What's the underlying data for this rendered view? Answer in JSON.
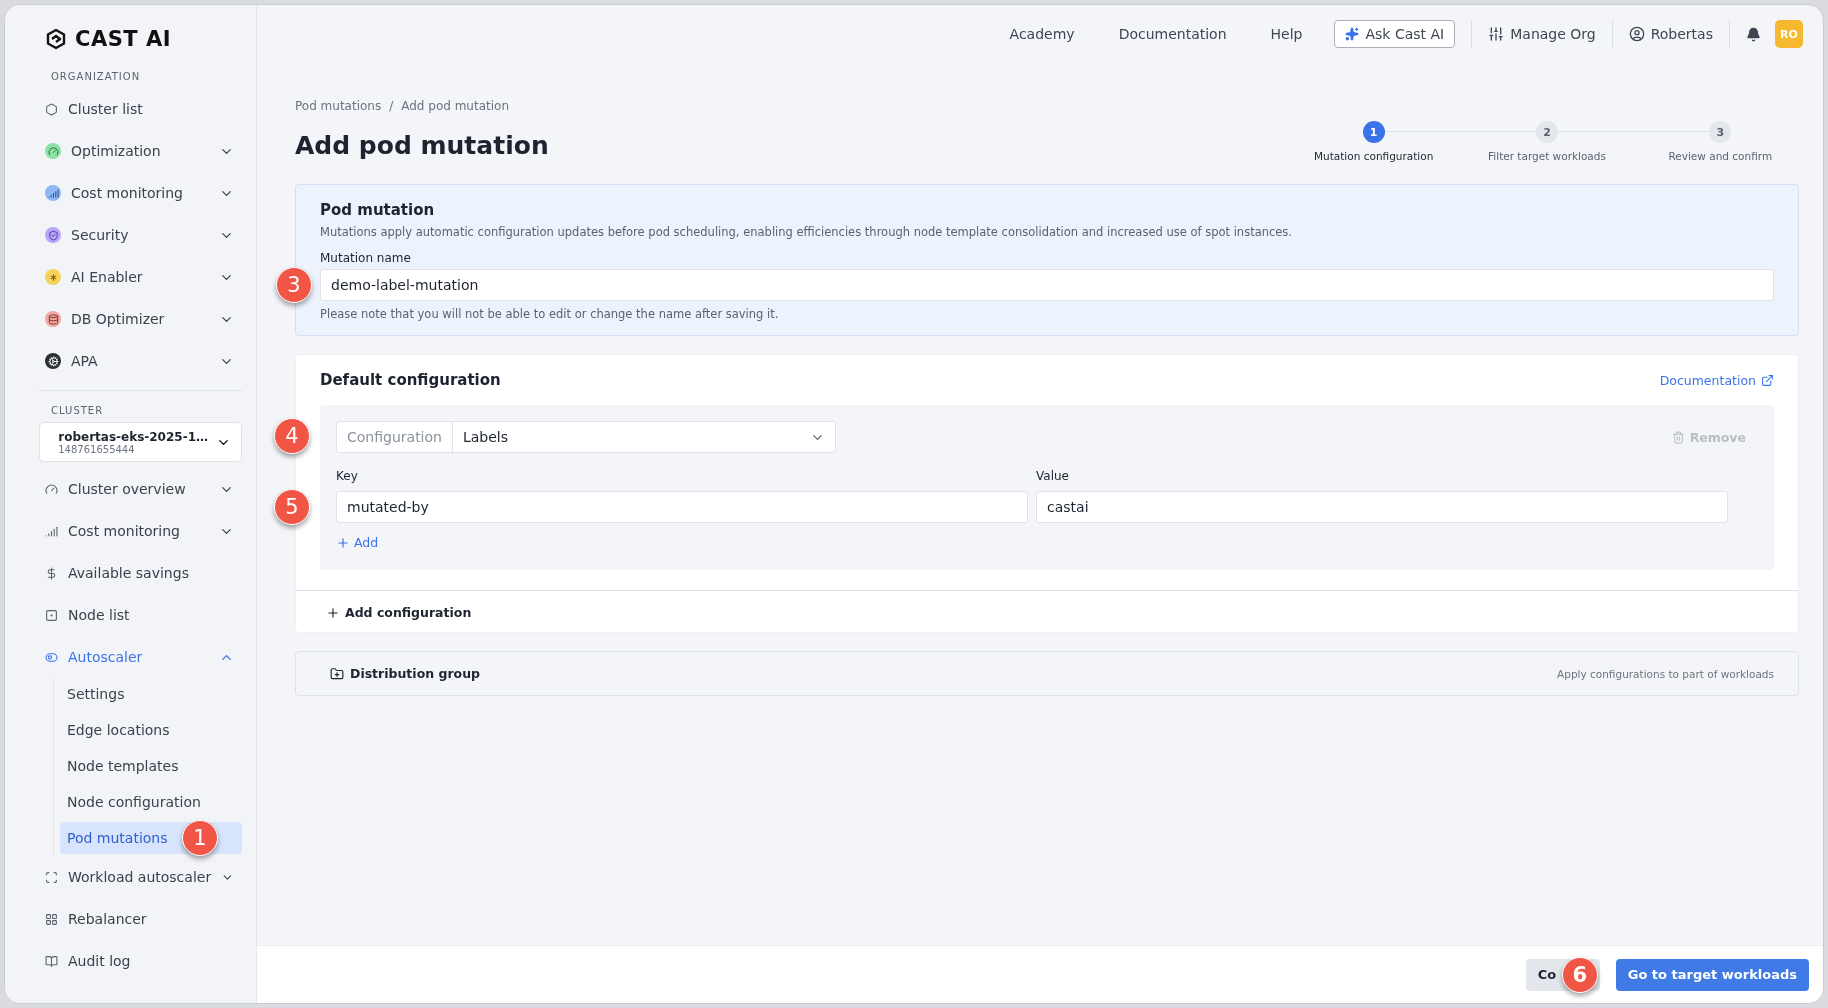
{
  "logo": {
    "text": "CAST AI"
  },
  "sidebar": {
    "sections": [
      {
        "heading": "ORGANIZATION",
        "items": [
          {
            "label": "Cluster list",
            "kind": "link",
            "selected": false
          },
          {
            "label": "Optimization",
            "kind": "group",
            "expanded": false,
            "selected": false
          },
          {
            "label": "Cost monitoring",
            "kind": "group",
            "expanded": false,
            "selected": false
          },
          {
            "label": "Security",
            "kind": "group",
            "expanded": false,
            "selected": false
          },
          {
            "label": "AI Enabler",
            "kind": "group",
            "expanded": false,
            "selected": false
          },
          {
            "label": "DB Optimizer",
            "kind": "group",
            "expanded": false,
            "selected": false
          },
          {
            "label": "APA",
            "kind": "group",
            "expanded": false,
            "selected": false
          }
        ]
      },
      {
        "heading": "CLUSTER",
        "cluster": {
          "name": "robertas-eks-2025-1…",
          "id": "148761655444"
        },
        "items": [
          {
            "label": "Cluster overview",
            "kind": "group",
            "expanded": false,
            "selected": false
          },
          {
            "label": "Cost monitoring",
            "kind": "group",
            "expanded": false,
            "selected": false
          },
          {
            "label": "Available savings",
            "kind": "link",
            "selected": false
          },
          {
            "label": "Node list",
            "kind": "link",
            "selected": false
          },
          {
            "label": "Autoscaler",
            "kind": "group",
            "expanded": true,
            "selected": true,
            "children": [
              {
                "label": "Settings",
                "selected": false
              },
              {
                "label": "Edge locations",
                "selected": false
              },
              {
                "label": "Node templates",
                "selected": false
              },
              {
                "label": "Node configuration",
                "selected": false
              },
              {
                "label": "Pod mutations",
                "selected": true,
                "callout": "1"
              }
            ]
          },
          {
            "label": "Workload autoscaler",
            "kind": "group",
            "expanded": false,
            "selected": false
          },
          {
            "label": "Rebalancer",
            "kind": "link",
            "selected": false
          },
          {
            "label": "Audit log",
            "kind": "link",
            "selected": false
          }
        ]
      }
    ]
  },
  "header": {
    "links": [
      "Academy",
      "Documentation",
      "Help"
    ],
    "ask_button": "Ask Cast AI",
    "manage_org": "Manage Org",
    "user": "Robertas",
    "avatar": "RO"
  },
  "breadcrumb": {
    "items": [
      "Pod mutations",
      "Add pod mutation"
    ],
    "separator": "/"
  },
  "title": "Add pod mutation",
  "stepper": [
    {
      "number": "1",
      "label": "Mutation configuration",
      "selected": true
    },
    {
      "number": "2",
      "label": "Filter target workloads",
      "selected": false
    },
    {
      "number": "3",
      "label": "Review and confirm",
      "selected": false
    }
  ],
  "pod_mutation": {
    "title": "Pod mutation",
    "description": "Mutations apply automatic configuration updates before pod scheduling, enabling efficiencies through node template consolidation and increased use of spot instances.",
    "field_label": "Mutation name",
    "value": "demo-label-mutation",
    "hint": "Please note that you will not be able to edit or change the name after saving it.",
    "callout": "3"
  },
  "default_configuration": {
    "title": "Default configuration",
    "doc_link": "Documentation",
    "select": {
      "addon": "Configuration",
      "value": "Labels",
      "callout": "4"
    },
    "remove": {
      "label": "Remove",
      "disabled": true
    },
    "pairs": {
      "key_label": "Key",
      "value_label": "Value",
      "key": "mutated-by",
      "value": "castai",
      "callout": "5"
    },
    "add": "Add",
    "add_configuration": "Add configuration"
  },
  "distribution_group": {
    "title": "Distribution group",
    "description": "Apply configurations to part of workloads"
  },
  "footer": {
    "secondary": "Co",
    "primary": "Go to target workloads",
    "callout": "6"
  }
}
